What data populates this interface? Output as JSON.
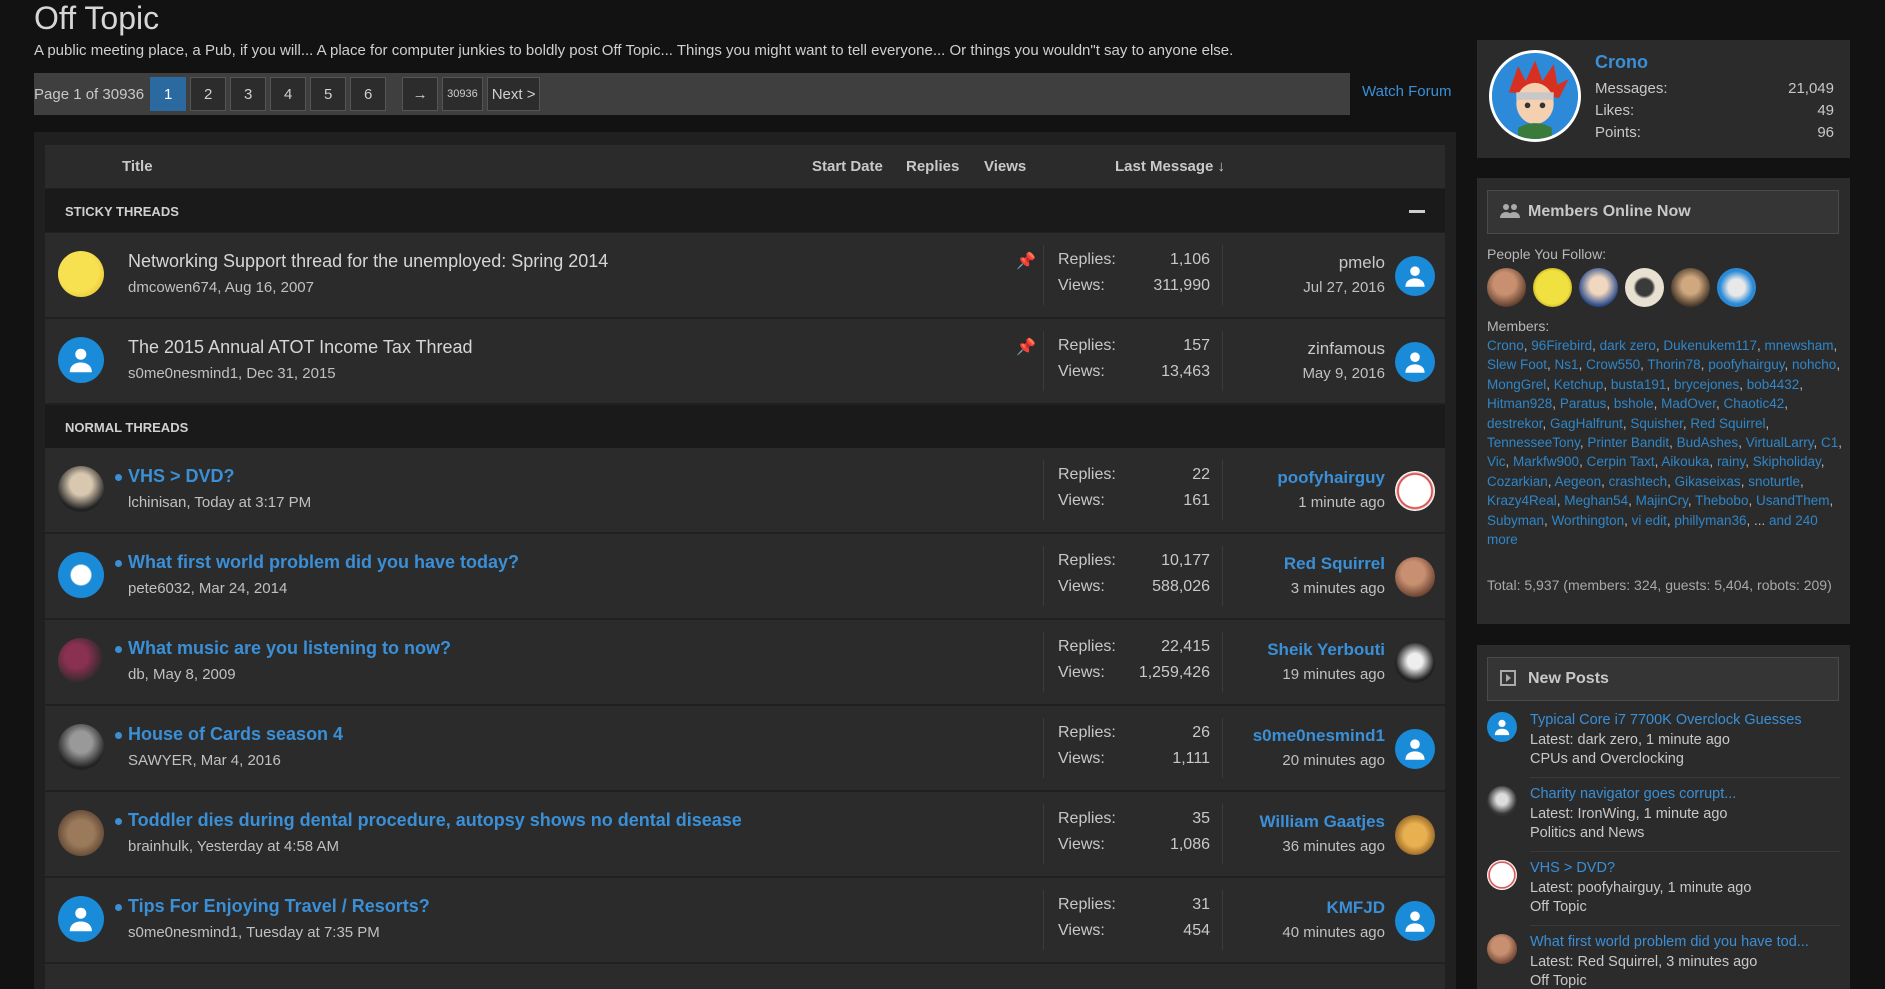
{
  "forum": {
    "title": "Off Topic",
    "description": "A public meeting place, a Pub, if you will... A place for computer junkies to boldly post Off Topic... Things you might want to tell everyone... Or things you wouldn\"t say to anyone else.",
    "watch_label": "Watch Forum"
  },
  "pagination": {
    "label": "Page 1 of 30936",
    "pages": [
      "1",
      "2",
      "3",
      "4",
      "5",
      "6"
    ],
    "arrow": "→",
    "last": "30936",
    "next": "Next >"
  },
  "table_header": {
    "title": "Title",
    "start_date": "Start Date",
    "replies": "Replies",
    "views": "Views",
    "last_message": "Last Message ↓"
  },
  "sections": {
    "sticky": "STICKY THREADS",
    "normal": "NORMAL THREADS"
  },
  "labels": {
    "replies": "Replies:",
    "views": "Views:"
  },
  "sticky_threads": [
    {
      "title": "Networking Support thread for the unemployed: Spring 2014",
      "meta": "dmcowen674, Aug 16, 2007",
      "replies": "1,106",
      "views": "311,990",
      "last_user": "pmelo",
      "last_time": "Jul 27, 2016"
    },
    {
      "title": "The 2015 Annual ATOT Income Tax Thread",
      "meta": "s0me0nesmind1, Dec 31, 2015",
      "replies": "157",
      "views": "13,463",
      "last_user": "zinfamous",
      "last_time": "May 9, 2016"
    }
  ],
  "normal_threads": [
    {
      "title": "VHS > DVD?",
      "meta": "lchinisan, Today at 3:17 PM",
      "replies": "22",
      "views": "161",
      "last_user": "poofyhairguy",
      "last_time": "1 minute ago"
    },
    {
      "title": "What first world problem did you have today?",
      "meta": "pete6032, Mar 24, 2014",
      "replies": "10,177",
      "views": "588,026",
      "last_user": "Red Squirrel",
      "last_time": "3 minutes ago"
    },
    {
      "title": "What music are you listening to now?",
      "meta": "db, May 8, 2009",
      "replies": "22,415",
      "views": "1,259,426",
      "last_user": "Sheik Yerbouti",
      "last_time": "19 minutes ago"
    },
    {
      "title": "House of Cards season 4",
      "meta": "SAWYER, Mar 4, 2016",
      "replies": "26",
      "views": "1,111",
      "last_user": "s0me0nesmind1",
      "last_time": "20 minutes ago"
    },
    {
      "title": "Toddler dies during dental procedure, autopsy shows no dental disease",
      "meta": "brainhulk, Yesterday at 4:58 AM",
      "replies": "35",
      "views": "1,086",
      "last_user": "William Gaatjes",
      "last_time": "36 minutes ago"
    },
    {
      "title": "Tips For Enjoying Travel / Resorts?",
      "meta": "s0me0nesmind1, Tuesday at 7:35 PM",
      "replies": "31",
      "views": "454",
      "last_user": "KMFJD",
      "last_time": "40 minutes ago"
    }
  ],
  "profile": {
    "name": "Crono",
    "messages_label": "Messages:",
    "messages": "21,049",
    "likes_label": "Likes:",
    "likes": "49",
    "points_label": "Points:",
    "points": "96"
  },
  "members_online": {
    "heading": "Members Online Now",
    "follow_label": "People You Follow:",
    "members_label": "Members:",
    "members": [
      "Crono",
      "96Firebird",
      "dark zero",
      "Dukenukem117",
      "mnewsham",
      "Slew Foot",
      "Ns1",
      "Crow550",
      "Thorin78",
      "poofyhairguy",
      "nohcho",
      "MongGrel",
      "Ketchup",
      "busta191",
      "brycejones",
      "bob4432",
      "Hitman928",
      "Paratus",
      "bshole",
      "MadOver",
      "Chaotic42",
      "destrekor",
      "GagHalfrunt",
      "Squisher",
      "Red Squirrel",
      "TennesseeTony",
      "Printer Bandit",
      "BudAshes",
      "VirtualLarry",
      "C1",
      "Vic",
      "Markfw900",
      "Cerpin Taxt",
      "Aikouka",
      "rainy",
      "Skipholiday",
      "Cozarkian",
      "Aegeon",
      "crashtech",
      "Gikaseixas",
      "snoturtle",
      "Krazy4Real",
      "Meghan54",
      "MajinCry",
      "Thebobo",
      "UsandThem",
      "Subyman",
      "Worthington",
      "vi edit",
      "phillyman36"
    ],
    "more_prefix": "... ",
    "more": "and 240 more",
    "total": "Total: 5,937 (members: 324, guests: 5,404, robots: 209)"
  },
  "new_posts": {
    "heading": "New Posts",
    "items": [
      {
        "title": "Typical Core i7 7700K Overclock Guesses",
        "latest": "Latest: dark zero, 1 minute ago",
        "forum": "CPUs and Overclocking"
      },
      {
        "title": "Charity navigator goes corrupt...",
        "latest": "Latest: IronWing, 1 minute ago",
        "forum": "Politics and News"
      },
      {
        "title": "VHS > DVD?",
        "latest": "Latest: poofyhairguy, 1 minute ago",
        "forum": "Off Topic"
      },
      {
        "title": "What first world problem did you have tod...",
        "latest": "Latest: Red Squirrel, 3 minutes ago",
        "forum": "Off Topic"
      }
    ]
  },
  "icons": [
    "pin-icon",
    "user-default-icon",
    "members-icon",
    "new-posts-icon",
    "collapse-icon"
  ]
}
